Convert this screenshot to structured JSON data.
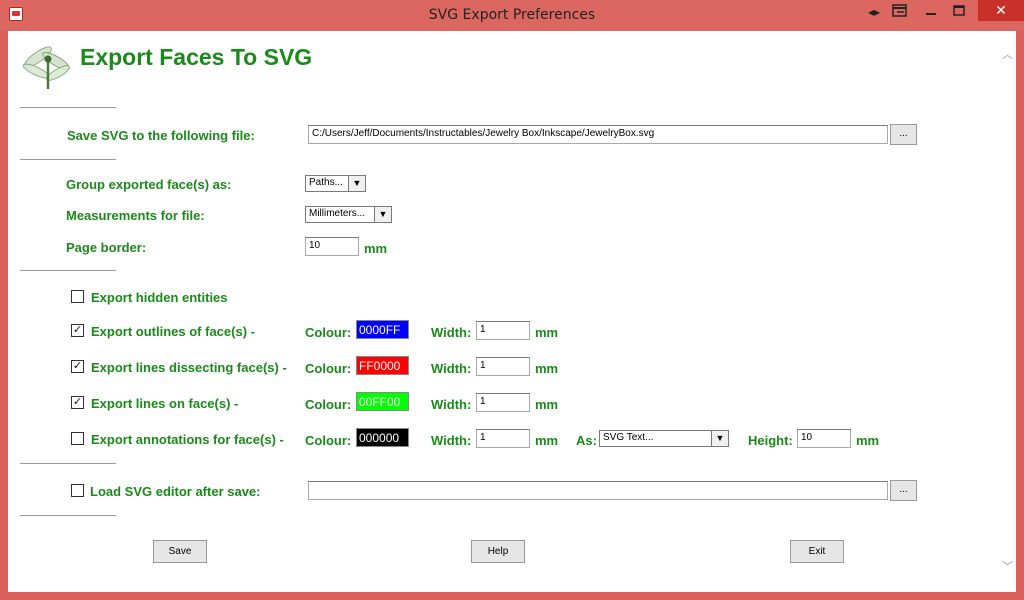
{
  "window": {
    "title": "SVG Export Preferences",
    "icons": {
      "app": "sketchup-icon",
      "arrows": "left-right-arrows-icon",
      "dock": "dock-icon",
      "minimize": "minimize-icon",
      "maximize": "maximize-icon",
      "close": "close-icon"
    }
  },
  "header": {
    "title": "Export Faces To SVG",
    "logo": "dragonfly-icon"
  },
  "save_file": {
    "label": "Save SVG to the following file:",
    "value": "C:/Users/Jeff/Documents/Instructables/Jewelry Box/Inkscape/JewelryBox.svg",
    "browse_label": "..."
  },
  "group": {
    "label": "Group exported face(s) as:",
    "selected": "Paths..."
  },
  "measurements": {
    "label": "Measurements for file:",
    "selected": "Millimeters..."
  },
  "page_border": {
    "label": "Page border:",
    "value": "10",
    "unit": "mm"
  },
  "hidden": {
    "label": "Export hidden entities",
    "checked": false
  },
  "rows": [
    {
      "label": "Export outlines of face(s) -",
      "checked": true,
      "colour_label": "Colour:",
      "colour": "0000FF",
      "width_label": "Width:",
      "width": "1",
      "unit": "mm"
    },
    {
      "label": "Export lines dissecting face(s) -",
      "checked": true,
      "colour_label": "Colour:",
      "colour": "FF0000",
      "width_label": "Width:",
      "width": "1",
      "unit": "mm"
    },
    {
      "label": "Export lines on face(s) -",
      "checked": true,
      "colour_label": "Colour:",
      "colour": "00FF00",
      "width_label": "Width:",
      "width": "1",
      "unit": "mm"
    },
    {
      "label": "Export annotations for face(s) -",
      "checked": false,
      "colour_label": "Colour:",
      "colour": "000000",
      "width_label": "Width:",
      "width": "1",
      "unit": "mm"
    }
  ],
  "annotations_extra": {
    "as_label": "As:",
    "as_selected": "SVG Text...",
    "height_label": "Height:",
    "height": "10",
    "unit": "mm"
  },
  "editor": {
    "label": "Load SVG editor after save:",
    "checked": false,
    "value": "",
    "browse_label": "..."
  },
  "buttons": {
    "save": "Save",
    "help": "Help",
    "exit": "Exit"
  },
  "colors": {
    "label_green": "#1a8a1a",
    "titlebar": "#dc6761",
    "close": "#c7312a"
  }
}
